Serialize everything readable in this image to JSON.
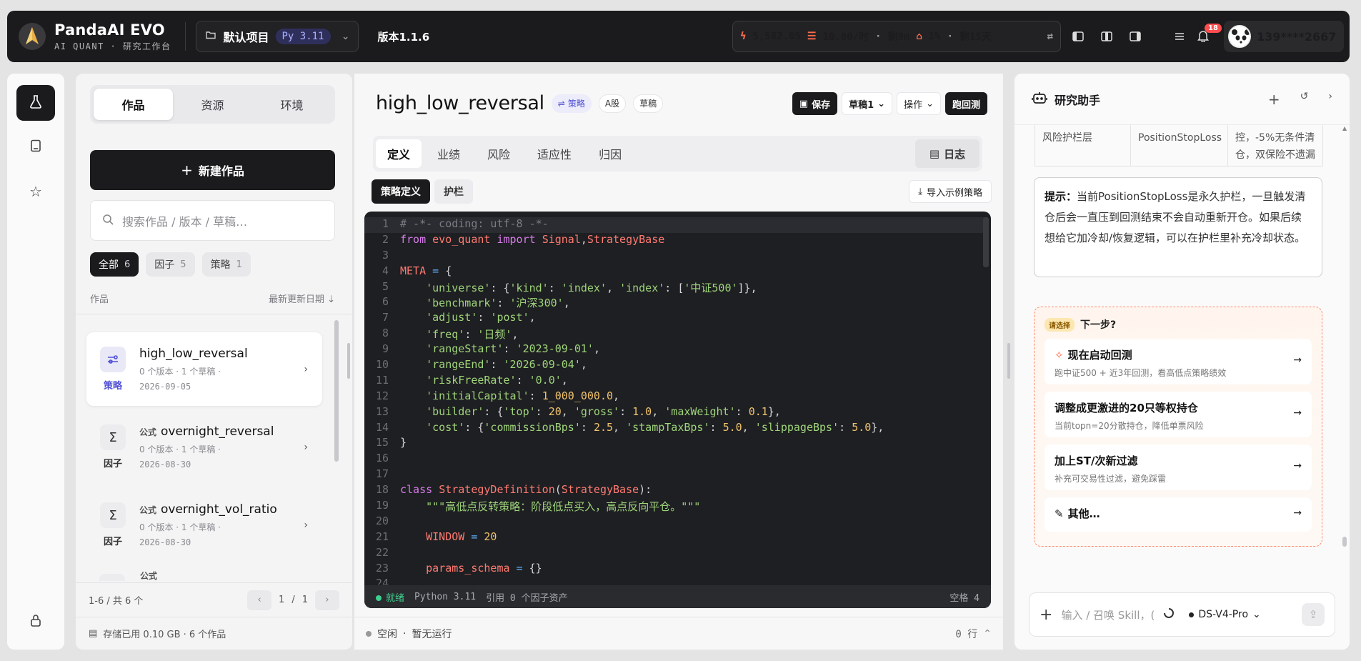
{
  "header": {
    "brand_name": "PandaAI EVO",
    "brand_sub": "AI QUANT · 研究工作台",
    "project_name": "默认项目",
    "python_badge": "Py 3.11",
    "version": "版本1.1.6",
    "stats": {
      "credits": "5,582.05",
      "rate": "10.00/时",
      "rate_remaining": "剩9m",
      "storage": "1%",
      "storage_remaining": "剩15天"
    },
    "notification_count": "18",
    "username": "139****2667"
  },
  "left_panel": {
    "tabs": [
      "作品",
      "资源",
      "环境"
    ],
    "new_button": "新建作品",
    "search_placeholder": "搜索作品 / 版本 / 草稿…",
    "filters": [
      {
        "label": "全部",
        "count": "6"
      },
      {
        "label": "因子",
        "count": "5"
      },
      {
        "label": "策略",
        "count": "1"
      }
    ],
    "list_header_left": "作品",
    "list_header_right": "最新更新日期",
    "items": [
      {
        "title": "high_low_reversal",
        "prefix": "",
        "meta": "0 个版本 · 1 个草稿 ·",
        "date": "2026-09-05",
        "type": "策略"
      },
      {
        "title": "overnight_reversal",
        "prefix": "公式",
        "meta": "0 个版本 · 1 个草稿 ·",
        "date": "2026-08-30",
        "type": "因子"
      },
      {
        "title": "overnight_vol_ratio",
        "prefix": "公式",
        "meta": "0 个版本 · 1 个草稿 ·",
        "date": "2026-08-30",
        "type": "因子"
      },
      {
        "title": "",
        "prefix": "公式",
        "meta": "",
        "date": "",
        "type": ""
      }
    ],
    "pager_summary": "1-6 / 共 6 个",
    "page_current": "1",
    "page_total": "1",
    "page_sep": "/",
    "storage": "存储已用 0.10 GB · 6 个作品"
  },
  "center": {
    "title": "high_low_reversal",
    "tags": [
      "策略",
      "A股",
      "草稿"
    ],
    "actions": {
      "save": "保存",
      "draft": "草稿1",
      "ops": "操作",
      "backtest": "跑回测"
    },
    "tabs": [
      "定义",
      "业绩",
      "风险",
      "适应性",
      "归因"
    ],
    "log_button": "日志",
    "subtabs": [
      "策略定义",
      "护栏"
    ],
    "import_button": "导入示例策略",
    "code_lines": [
      [
        [
          "cm",
          "# -*- coding: utf-8 -*-"
        ]
      ],
      [
        [
          "kw",
          "from "
        ],
        [
          "cls",
          "evo_quant"
        ],
        [
          "kw",
          " import "
        ],
        [
          "cls",
          "Signal"
        ],
        [
          "",
          ","
        ],
        [
          "cls",
          "StrategyBase"
        ]
      ],
      [],
      [
        [
          "cls",
          "META"
        ],
        [
          "",
          " "
        ],
        [
          "op",
          "="
        ],
        [
          "",
          " {"
        ]
      ],
      [
        [
          "",
          "    "
        ],
        [
          "str",
          "'universe'"
        ],
        [
          "",
          ": {"
        ],
        [
          "str",
          "'kind'"
        ],
        [
          "",
          ": "
        ],
        [
          "str",
          "'index'"
        ],
        [
          "",
          ", "
        ],
        [
          "str",
          "'index'"
        ],
        [
          "",
          ": ["
        ],
        [
          "str",
          "'中证500'"
        ],
        [
          "",
          "]},"
        ]
      ],
      [
        [
          "",
          "    "
        ],
        [
          "str",
          "'benchmark'"
        ],
        [
          "",
          ": "
        ],
        [
          "str",
          "'沪深300'"
        ],
        [
          "",
          ","
        ]
      ],
      [
        [
          "",
          "    "
        ],
        [
          "str",
          "'adjust'"
        ],
        [
          "",
          ": "
        ],
        [
          "str",
          "'post'"
        ],
        [
          "",
          ","
        ]
      ],
      [
        [
          "",
          "    "
        ],
        [
          "str",
          "'freq'"
        ],
        [
          "",
          ": "
        ],
        [
          "str",
          "'日频'"
        ],
        [
          "",
          ","
        ]
      ],
      [
        [
          "",
          "    "
        ],
        [
          "str",
          "'rangeStart'"
        ],
        [
          "",
          ": "
        ],
        [
          "str",
          "'2023-09-01'"
        ],
        [
          "",
          ","
        ]
      ],
      [
        [
          "",
          "    "
        ],
        [
          "str",
          "'rangeEnd'"
        ],
        [
          "",
          ": "
        ],
        [
          "str",
          "'2026-09-04'"
        ],
        [
          "",
          ","
        ]
      ],
      [
        [
          "",
          "    "
        ],
        [
          "str",
          "'riskFreeRate'"
        ],
        [
          "",
          ": "
        ],
        [
          "str",
          "'0.0'"
        ],
        [
          "",
          ","
        ]
      ],
      [
        [
          "",
          "    "
        ],
        [
          "str",
          "'initialCapital'"
        ],
        [
          "",
          ": "
        ],
        [
          "num",
          "1_000_000.0"
        ],
        [
          "",
          ","
        ]
      ],
      [
        [
          "",
          "    "
        ],
        [
          "str",
          "'builder'"
        ],
        [
          "",
          ": {"
        ],
        [
          "str",
          "'top'"
        ],
        [
          "",
          ": "
        ],
        [
          "num",
          "20"
        ],
        [
          "",
          ", "
        ],
        [
          "str",
          "'gross'"
        ],
        [
          "",
          ": "
        ],
        [
          "num",
          "1.0"
        ],
        [
          "",
          ", "
        ],
        [
          "str",
          "'maxWeight'"
        ],
        [
          "",
          ": "
        ],
        [
          "num",
          "0.1"
        ],
        [
          "",
          "},"
        ]
      ],
      [
        [
          "",
          "    "
        ],
        [
          "str",
          "'cost'"
        ],
        [
          "",
          ": {"
        ],
        [
          "str",
          "'commissionBps'"
        ],
        [
          "",
          ": "
        ],
        [
          "num",
          "2.5"
        ],
        [
          "",
          ", "
        ],
        [
          "str",
          "'stampTaxBps'"
        ],
        [
          "",
          ": "
        ],
        [
          "num",
          "5.0"
        ],
        [
          "",
          ", "
        ],
        [
          "str",
          "'slippageBps'"
        ],
        [
          "",
          ": "
        ],
        [
          "num",
          "5.0"
        ],
        [
          "",
          "},"
        ]
      ],
      [
        [
          "",
          "}"
        ]
      ],
      [],
      [],
      [
        [
          "kw",
          "class "
        ],
        [
          "cls",
          "StrategyDefinition"
        ],
        [
          "",
          "("
        ],
        [
          "cls",
          "StrategyBase"
        ],
        [
          "",
          "):"
        ]
      ],
      [
        [
          "",
          "    "
        ],
        [
          "str",
          "\"\"\"高低点反转策略：阶段低点买入，高点反向平仓。\"\"\""
        ]
      ],
      [],
      [
        [
          "",
          "    "
        ],
        [
          "cls",
          "WINDOW"
        ],
        [
          "",
          " "
        ],
        [
          "op",
          "="
        ],
        [
          "",
          " "
        ],
        [
          "num",
          "20"
        ]
      ],
      [],
      [
        [
          "",
          "    "
        ],
        [
          "cls",
          "params_schema"
        ],
        [
          "",
          " "
        ],
        [
          "op",
          "="
        ],
        [
          "",
          " {}"
        ]
      ],
      []
    ],
    "status": {
      "state": "就绪",
      "python": "Python 3.11",
      "ref": "引用 0 个因子资产",
      "indent": "空格 4"
    },
    "footer": {
      "state": "空闲",
      "run": "暂无运行",
      "rows": "0 行"
    }
  },
  "right_panel": {
    "title": "研究助手",
    "table": {
      "col1": "风险护栏层",
      "col2": "PositionStopLoss",
      "col3": "控，-5%无条件清仓，双保险不遗漏"
    },
    "tip_label": "提示：",
    "tip_text": "当前PositionStopLoss是永久护栏，一旦触发清仓后会一直压到回测结束不会自动重新开仓。如果后续想给它加冷却/恢复逻辑，可以在护栏里补充冷却状态。",
    "next_pill": "请选择",
    "next_title": "下一步?",
    "options": [
      {
        "title": "现在启动回测",
        "sub": "跑中证500 + 近3年回测，看高低点策略绩效"
      },
      {
        "title": "调整成更激进的20只等权持仓",
        "sub": "当前topn=20分散持仓，降低单票风险"
      },
      {
        "title": "加上ST/次新过滤",
        "sub": "补充可交易性过滤，避免踩雷"
      },
      {
        "title": "其他…",
        "sub": ""
      }
    ],
    "composer_placeholder": "输入 / 召唤 Skill，(",
    "model": "DS-V4-Pro"
  },
  "colors": {
    "accent": "#4f4fd6",
    "dark": "#1b1b1d",
    "alert": "#ff4d4f",
    "orange": "#ff6b4a"
  }
}
